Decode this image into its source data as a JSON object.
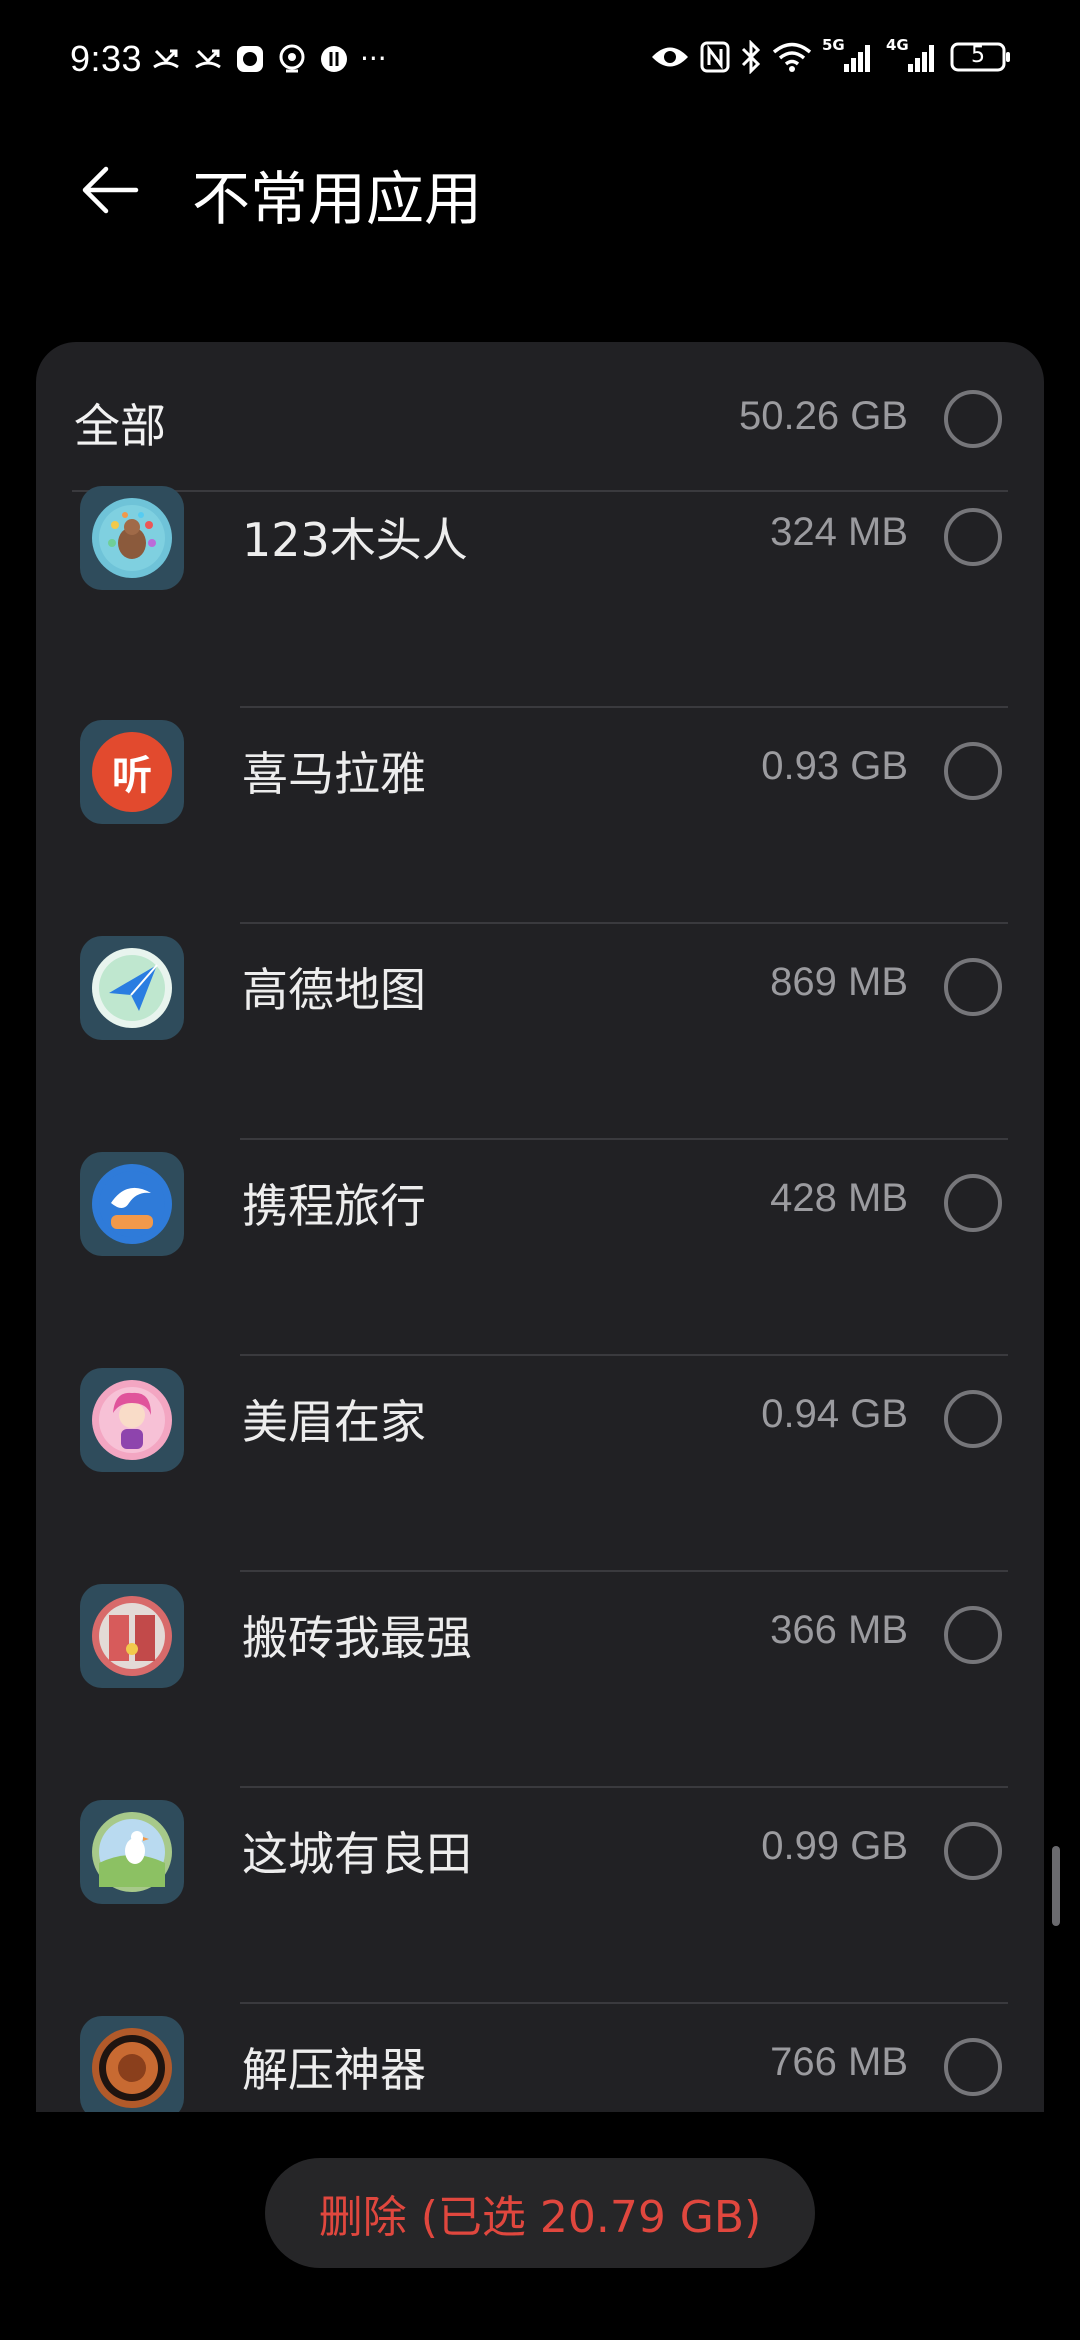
{
  "status_bar": {
    "time": "9:33",
    "left_icons": [
      "missed-call-icon",
      "missed-call-icon",
      "app-notification-icon",
      "app-notification-icon",
      "app-notification-icon",
      "more-dots-icon"
    ],
    "more": "···",
    "right_icons": [
      "eye-comfort-icon",
      "nfc-icon",
      "bluetooth-icon",
      "wifi-icon",
      "signal-5g-icon",
      "signal-4g-icon",
      "battery-icon"
    ],
    "net1": "5G",
    "net2": "4G",
    "battery": "5"
  },
  "header": {
    "title": "不常用应用"
  },
  "all_row": {
    "label": "全部",
    "size": "50.26 GB"
  },
  "apps": [
    {
      "name": "123木头人",
      "size": "324 MB",
      "icon": "turkey-game-icon",
      "color": "#6fc3d8"
    },
    {
      "name": "喜马拉雅",
      "size": "0.93 GB",
      "icon": "ximalaya-icon",
      "color": "#e24a2e",
      "glyph": "听"
    },
    {
      "name": "高德地图",
      "size": "869 MB",
      "icon": "amap-icon",
      "color": "#8fd6a8"
    },
    {
      "name": "携程旅行",
      "size": "428 MB",
      "icon": "ctrip-icon",
      "color": "#2f7bd9"
    },
    {
      "name": "美眉在家",
      "size": "0.94 GB",
      "icon": "girl-game-icon",
      "color": "#f3a6c2"
    },
    {
      "name": "搬砖我最强",
      "size": "366 MB",
      "icon": "brick-game-icon",
      "color": "#d86a6a"
    },
    {
      "name": "这城有良田",
      "size": "0.99 GB",
      "icon": "farm-game-icon",
      "color": "#a7c98a"
    },
    {
      "name": "解压神器",
      "size": "766 MB",
      "icon": "anti-stress-icon",
      "color": "#b25a2a"
    }
  ],
  "footer": {
    "delete_label": "删除 (已选 20.79 GB)"
  },
  "colors": {
    "background": "#000000",
    "card": "#212124",
    "accent_red": "#e0473e",
    "secondary_text": "#9b9b9f"
  }
}
